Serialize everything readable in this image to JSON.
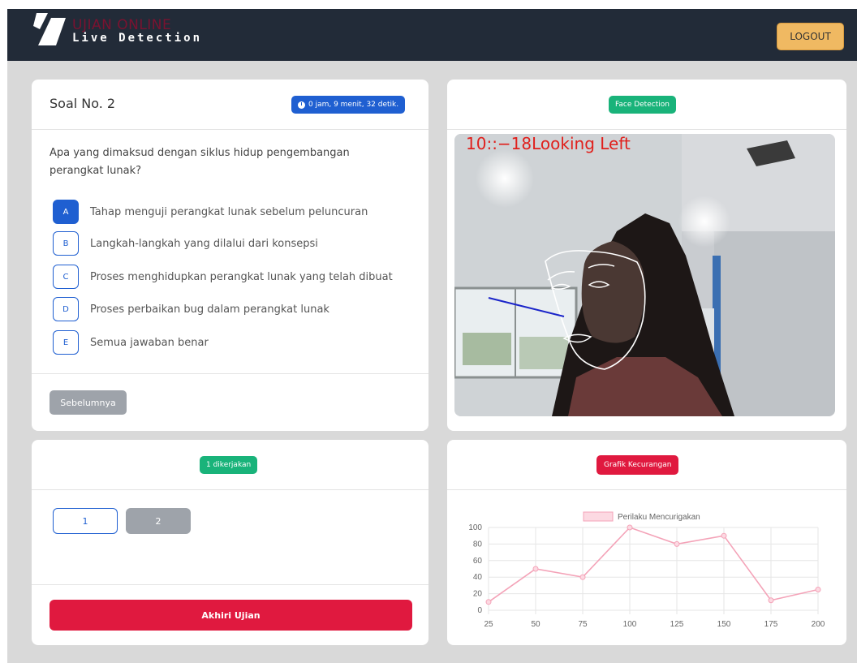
{
  "header": {
    "logo_title": "UJIAN ONLINE",
    "logo_subtitle": "Live Detection",
    "logout_label": "LOGOUT"
  },
  "question": {
    "title": "Soal No. 2",
    "timer": "0 jam, 9 menit, 32 detik.",
    "text": "Apa yang dimaksud dengan siklus hidup pengembangan perangkat lunak?",
    "options": [
      {
        "letter": "A",
        "text": "Tahap menguji perangkat lunak sebelum peluncuran",
        "selected": true
      },
      {
        "letter": "B",
        "text": "Langkah-langkah yang dilalui dari konsepsi",
        "selected": false
      },
      {
        "letter": "C",
        "text": "Proses menghidupkan perangkat lunak yang telah dibuat",
        "selected": false
      },
      {
        "letter": "D",
        "text": "Proses perbaikan bug dalam perangkat lunak",
        "selected": false
      },
      {
        "letter": "E",
        "text": "Semua jawaban benar",
        "selected": false
      }
    ],
    "prev_label": "Sebelumnya"
  },
  "face": {
    "badge": "Face Detection",
    "overlay_text": "10::−18Looking Left"
  },
  "navigation": {
    "badge": "1 dikerjakan",
    "numbers": [
      "1",
      "2"
    ],
    "end_label": "Akhiri Ujian"
  },
  "chart_card": {
    "badge": "Grafik Kecurangan"
  },
  "chart_data": {
    "type": "line",
    "x": [
      25,
      50,
      75,
      100,
      125,
      150,
      175,
      200
    ],
    "series": [
      {
        "name": "Perilaku Mencurigakan",
        "values": [
          10,
          50,
          40,
          100,
          80,
          90,
          12,
          25
        ]
      }
    ],
    "ylim": [
      0,
      100
    ],
    "yticks": [
      0,
      20,
      40,
      60,
      80,
      100
    ],
    "grid": true,
    "legend": "top-center",
    "color": "#f4a3b8"
  },
  "colors": {
    "primary": "#1f5fd1",
    "success": "#19b37a",
    "danger": "#e0193f",
    "navbar": "#222b38",
    "logout": "#f0b962"
  }
}
